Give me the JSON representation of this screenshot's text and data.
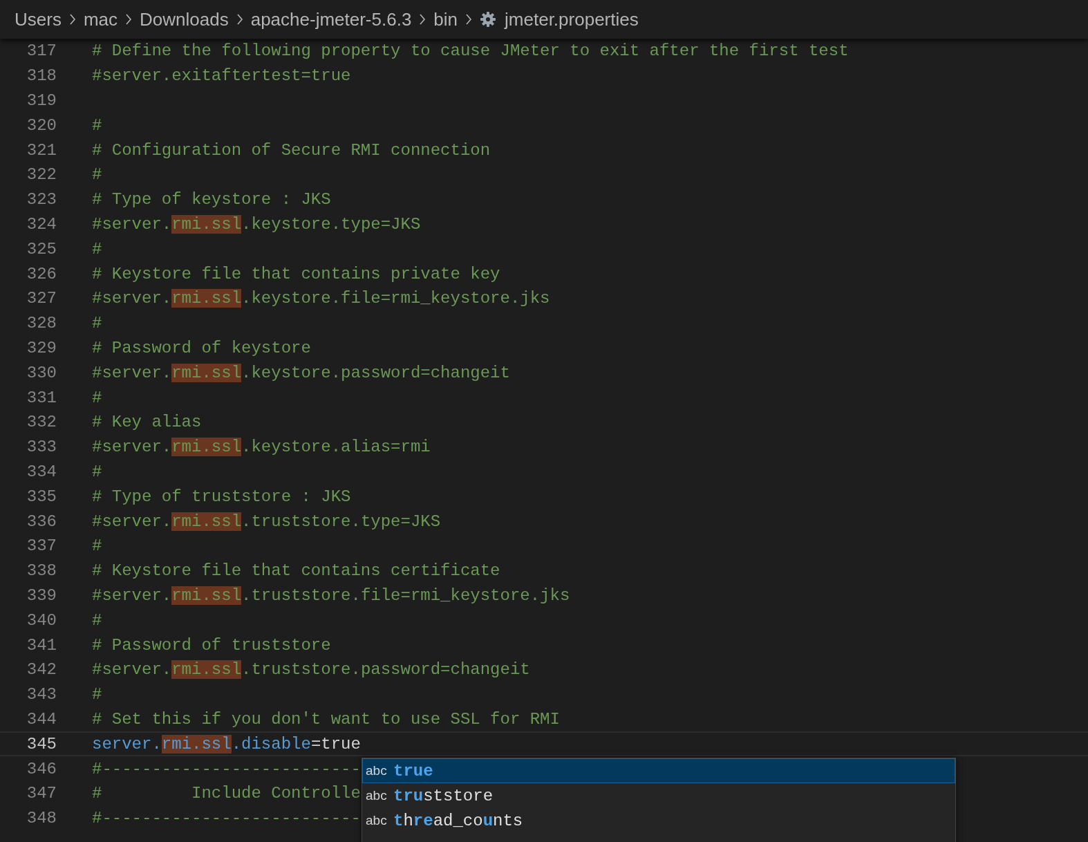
{
  "breadcrumb": [
    {
      "label": "Users"
    },
    {
      "label": "mac"
    },
    {
      "label": "Downloads"
    },
    {
      "label": "apache-jmeter-5.6.3"
    },
    {
      "label": "bin"
    },
    {
      "label": "jmeter.properties"
    }
  ],
  "editor": {
    "lines": [
      {
        "number": "317",
        "active": false,
        "segments": [
          {
            "kind": "comment",
            "text": "# Define the following property to cause JMeter to exit after the first test",
            "find_match": false
          }
        ]
      },
      {
        "number": "318",
        "active": false,
        "segments": [
          {
            "kind": "comment",
            "text": "#server.exitaftertest=true",
            "find_match": false
          }
        ]
      },
      {
        "number": "319",
        "active": false
      },
      {
        "number": "320",
        "active": false,
        "segments": [
          {
            "kind": "comment",
            "text": "#",
            "find_match": false
          }
        ]
      },
      {
        "number": "321",
        "active": false,
        "segments": [
          {
            "kind": "comment",
            "text": "# Configuration of Secure RMI connection",
            "find_match": false
          }
        ]
      },
      {
        "number": "322",
        "active": false,
        "segments": [
          {
            "kind": "comment",
            "text": "#",
            "find_match": false
          }
        ]
      },
      {
        "number": "323",
        "active": false,
        "segments": [
          {
            "kind": "comment",
            "text": "# Type of keystore : JKS",
            "find_match": false
          }
        ]
      },
      {
        "number": "324",
        "active": false,
        "segments": [
          {
            "kind": "comment",
            "text": "#server.",
            "find_match": false
          },
          {
            "kind": "comment",
            "text": "rmi.ssl",
            "find_match": true
          },
          {
            "kind": "comment",
            "text": ".keystore.type=JKS",
            "find_match": false
          }
        ]
      },
      {
        "number": "325",
        "active": false,
        "segments": [
          {
            "kind": "comment",
            "text": "#",
            "find_match": false
          }
        ]
      },
      {
        "number": "326",
        "active": false,
        "segments": [
          {
            "kind": "comment",
            "text": "# Keystore file that contains private key",
            "find_match": false
          }
        ]
      },
      {
        "number": "327",
        "active": false,
        "segments": [
          {
            "kind": "comment",
            "text": "#server.",
            "find_match": false
          },
          {
            "kind": "comment",
            "text": "rmi.ssl",
            "find_match": true
          },
          {
            "kind": "comment",
            "text": ".keystore.file=rmi_keystore.jks",
            "find_match": false
          }
        ]
      },
      {
        "number": "328",
        "active": false,
        "segments": [
          {
            "kind": "comment",
            "text": "#",
            "find_match": false
          }
        ]
      },
      {
        "number": "329",
        "active": false,
        "segments": [
          {
            "kind": "comment",
            "text": "# Password of keystore",
            "find_match": false
          }
        ]
      },
      {
        "number": "330",
        "active": false,
        "segments": [
          {
            "kind": "comment",
            "text": "#server.",
            "find_match": false
          },
          {
            "kind": "comment",
            "text": "rmi.ssl",
            "find_match": true
          },
          {
            "kind": "comment",
            "text": ".keystore.password=changeit",
            "find_match": false
          }
        ]
      },
      {
        "number": "331",
        "active": false,
        "segments": [
          {
            "kind": "comment",
            "text": "#",
            "find_match": false
          }
        ]
      },
      {
        "number": "332",
        "active": false,
        "segments": [
          {
            "kind": "comment",
            "text": "# Key alias",
            "find_match": false
          }
        ]
      },
      {
        "number": "333",
        "active": false,
        "segments": [
          {
            "kind": "comment",
            "text": "#server.",
            "find_match": false
          },
          {
            "kind": "comment",
            "text": "rmi.ssl",
            "find_match": true
          },
          {
            "kind": "comment",
            "text": ".keystore.alias=rmi",
            "find_match": false
          }
        ]
      },
      {
        "number": "334",
        "active": false,
        "segments": [
          {
            "kind": "comment",
            "text": "#",
            "find_match": false
          }
        ]
      },
      {
        "number": "335",
        "active": false,
        "segments": [
          {
            "kind": "comment",
            "text": "# Type of truststore : JKS",
            "find_match": false
          }
        ]
      },
      {
        "number": "336",
        "active": false,
        "segments": [
          {
            "kind": "comment",
            "text": "#server.",
            "find_match": false
          },
          {
            "kind": "comment",
            "text": "rmi.ssl",
            "find_match": true
          },
          {
            "kind": "comment",
            "text": ".truststore.type=JKS",
            "find_match": false
          }
        ]
      },
      {
        "number": "337",
        "active": false,
        "segments": [
          {
            "kind": "comment",
            "text": "#",
            "find_match": false
          }
        ]
      },
      {
        "number": "338",
        "active": false,
        "segments": [
          {
            "kind": "comment",
            "text": "# Keystore file that contains certificate",
            "find_match": false
          }
        ]
      },
      {
        "number": "339",
        "active": false,
        "segments": [
          {
            "kind": "comment",
            "text": "#server.",
            "find_match": false
          },
          {
            "kind": "comment",
            "text": "rmi.ssl",
            "find_match": true
          },
          {
            "kind": "comment",
            "text": ".truststore.file=rmi_keystore.jks",
            "find_match": false
          }
        ]
      },
      {
        "number": "340",
        "active": false,
        "segments": [
          {
            "kind": "comment",
            "text": "#",
            "find_match": false
          }
        ]
      },
      {
        "number": "341",
        "active": false,
        "segments": [
          {
            "kind": "comment",
            "text": "# Password of truststore",
            "find_match": false
          }
        ]
      },
      {
        "number": "342",
        "active": false,
        "segments": [
          {
            "kind": "comment",
            "text": "#server.",
            "find_match": false
          },
          {
            "kind": "comment",
            "text": "rmi.ssl",
            "find_match": true
          },
          {
            "kind": "comment",
            "text": ".truststore.password=changeit",
            "find_match": false
          }
        ]
      },
      {
        "number": "343",
        "active": false,
        "segments": [
          {
            "kind": "comment",
            "text": "#",
            "find_match": false
          }
        ]
      },
      {
        "number": "344",
        "active": false,
        "segments": [
          {
            "kind": "comment",
            "text": "# Set this if you don't want to use SSL for RMI",
            "find_match": false
          }
        ]
      },
      {
        "number": "345",
        "active": true,
        "segments": [
          {
            "kind": "key",
            "text": "server.",
            "find_match": false
          },
          {
            "kind": "key",
            "text": "rmi.ssl",
            "find_match": true
          },
          {
            "kind": "key",
            "text": ".disable",
            "find_match": false
          },
          {
            "kind": "value",
            "text": "=true",
            "find_match": false
          }
        ]
      },
      {
        "number": "346",
        "active": false,
        "segments": [
          {
            "kind": "comment",
            "text": "#--------------------------",
            "find_match": false
          }
        ]
      },
      {
        "number": "347",
        "active": false,
        "segments": [
          {
            "kind": "comment",
            "text": "#         Include Controlle",
            "find_match": false
          }
        ]
      },
      {
        "number": "348",
        "active": false,
        "segments": [
          {
            "kind": "comment",
            "text": "#--------------------------",
            "find_match": false
          }
        ]
      }
    ]
  },
  "suggestions": [
    {
      "type_label": "abc",
      "selected": true,
      "parts": [
        {
          "text": "true",
          "match": true
        }
      ]
    },
    {
      "type_label": "abc",
      "selected": false,
      "parts": [
        {
          "text": "tru",
          "match": true
        },
        {
          "text": "ststore",
          "match": false
        }
      ]
    },
    {
      "type_label": "abc",
      "selected": false,
      "parts": [
        {
          "text": "t",
          "match": true
        },
        {
          "text": "h",
          "match": false
        },
        {
          "text": "r",
          "match": true
        },
        {
          "text": "e",
          "match": true
        },
        {
          "text": "ad_co",
          "match": false
        },
        {
          "text": "u",
          "match": true
        },
        {
          "text": "nts",
          "match": false
        }
      ]
    }
  ]
}
